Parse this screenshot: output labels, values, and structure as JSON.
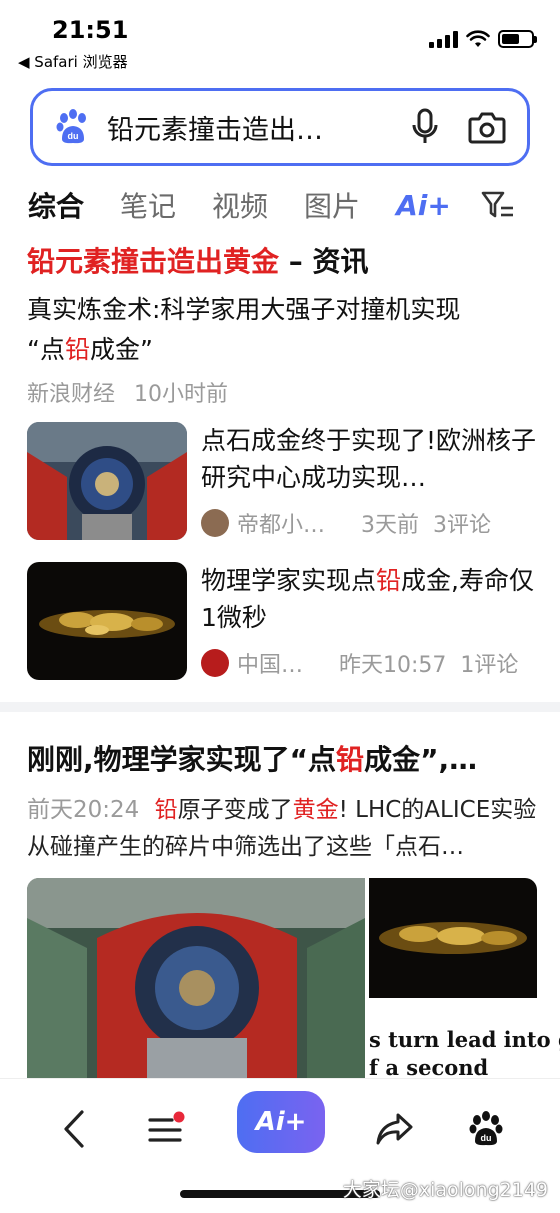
{
  "status_bar": {
    "time": "21:51",
    "back_app": "◀ Safari 浏览器"
  },
  "search": {
    "query": "铅元素撞击造出…",
    "brand_icon": "baidu-paw-icon",
    "mic_icon": "microphone-icon",
    "camera_icon": "camera-icon",
    "accent": "#4e6ef2"
  },
  "tabs": [
    {
      "label": "综合",
      "active": true
    },
    {
      "label": "笔记"
    },
    {
      "label": "视频"
    },
    {
      "label": "图片"
    },
    {
      "label": "Ai+"
    }
  ],
  "filter_icon": "filter-icon",
  "card1": {
    "title_highlight": "铅元素撞击造出黄金",
    "title_rest": " – 资讯",
    "subtitle_a": "真实炼金术:科学家用大强子对撞机实现",
    "subtitle_b": "“点",
    "subtitle_hl": "铅",
    "subtitle_c": "成金”",
    "source": "新浪财经",
    "time": "10小时前",
    "items": [
      {
        "title": "点石成金终于实现了!欧洲核子研究中心成功实现…",
        "source": "帝都小…",
        "time": "3天前",
        "comments": "3评论"
      },
      {
        "title_a": "物理学家实现点",
        "title_hl": "铅",
        "title_b": "成金,寿命仅1微秒",
        "source": "中国…",
        "time": "昨天10:57",
        "comments": "1评论"
      }
    ]
  },
  "card2": {
    "title_a": "刚刚,物理学家实现了“点",
    "title_hl": "铅",
    "title_b": "成金”,…",
    "time": "前天20:24",
    "text_hl1": "铅",
    "text_a": "原子变成了",
    "text_hl2": "黄金",
    "text_b": "! LHC的ALICE实验从碰撞产生的碎片中筛选出了这些「点石…",
    "image_caption_line1": "s turn lead into go",
    "image_caption_line2": "f a second"
  },
  "bottom_bar": {
    "back_icon": "back-chevron-icon",
    "menu_icon": "menu-icon",
    "ai_label": "Ai+",
    "share_icon": "share-icon",
    "home_icon": "baidu-paw-icon"
  },
  "watermark": "大家坛@xiaolong2149",
  "colors": {
    "highlight_red": "#e02222",
    "meta_gray": "#9a9a9a"
  }
}
